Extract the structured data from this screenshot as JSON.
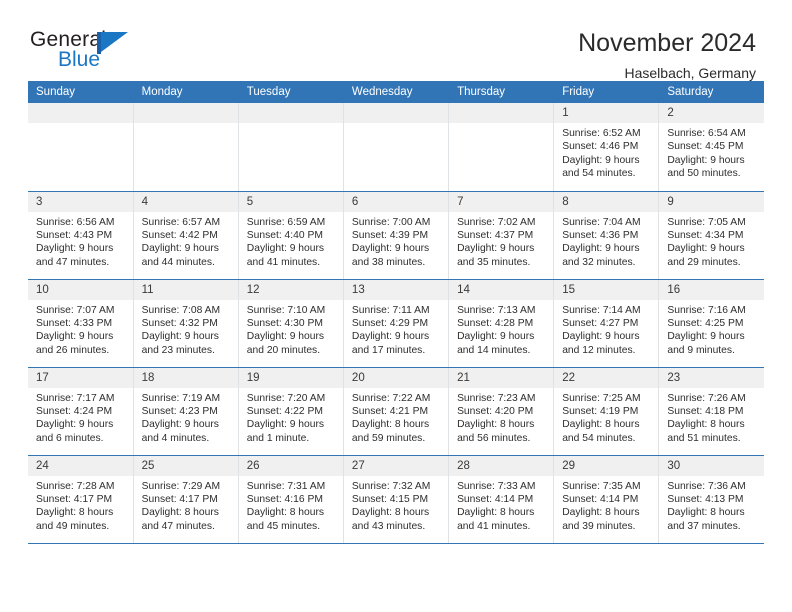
{
  "logo": {
    "word_top": "General",
    "word_bottom": "Blue",
    "flag_icon": "general-blue-flag-icon",
    "color_blue": "#1b77c4",
    "color_dark_blue": "#1b5fa8",
    "color_text": "#231f20"
  },
  "header": {
    "month_year": "November 2024",
    "location": "Haselbach, Germany"
  },
  "theme": {
    "header_blue": "#3275b6",
    "daynum_band": "#f0f0f0",
    "row_divider": "#3275b6",
    "column_divider": "#dfe3e6"
  },
  "calendar": {
    "weekday_headers": [
      "Sunday",
      "Monday",
      "Tuesday",
      "Wednesday",
      "Thursday",
      "Friday",
      "Saturday"
    ],
    "labels": {
      "sunrise": "Sunrise:",
      "sunset": "Sunset:",
      "daylight": "Daylight:"
    },
    "weeks": [
      [
        {
          "day": "",
          "blank": true,
          "sunrise": "",
          "sunset": "",
          "daylight_line1": "",
          "daylight_line2": ""
        },
        {
          "day": "",
          "blank": true,
          "sunrise": "",
          "sunset": "",
          "daylight_line1": "",
          "daylight_line2": ""
        },
        {
          "day": "",
          "blank": true,
          "sunrise": "",
          "sunset": "",
          "daylight_line1": "",
          "daylight_line2": ""
        },
        {
          "day": "",
          "blank": true,
          "sunrise": "",
          "sunset": "",
          "daylight_line1": "",
          "daylight_line2": ""
        },
        {
          "day": "",
          "blank": true,
          "sunrise": "",
          "sunset": "",
          "daylight_line1": "",
          "daylight_line2": ""
        },
        {
          "day": "1",
          "blank": false,
          "sunrise": "Sunrise: 6:52 AM",
          "sunset": "Sunset: 4:46 PM",
          "daylight_line1": "Daylight: 9 hours",
          "daylight_line2": "and 54 minutes."
        },
        {
          "day": "2",
          "blank": false,
          "sunrise": "Sunrise: 6:54 AM",
          "sunset": "Sunset: 4:45 PM",
          "daylight_line1": "Daylight: 9 hours",
          "daylight_line2": "and 50 minutes."
        }
      ],
      [
        {
          "day": "3",
          "blank": false,
          "sunrise": "Sunrise: 6:56 AM",
          "sunset": "Sunset: 4:43 PM",
          "daylight_line1": "Daylight: 9 hours",
          "daylight_line2": "and 47 minutes."
        },
        {
          "day": "4",
          "blank": false,
          "sunrise": "Sunrise: 6:57 AM",
          "sunset": "Sunset: 4:42 PM",
          "daylight_line1": "Daylight: 9 hours",
          "daylight_line2": "and 44 minutes."
        },
        {
          "day": "5",
          "blank": false,
          "sunrise": "Sunrise: 6:59 AM",
          "sunset": "Sunset: 4:40 PM",
          "daylight_line1": "Daylight: 9 hours",
          "daylight_line2": "and 41 minutes."
        },
        {
          "day": "6",
          "blank": false,
          "sunrise": "Sunrise: 7:00 AM",
          "sunset": "Sunset: 4:39 PM",
          "daylight_line1": "Daylight: 9 hours",
          "daylight_line2": "and 38 minutes."
        },
        {
          "day": "7",
          "blank": false,
          "sunrise": "Sunrise: 7:02 AM",
          "sunset": "Sunset: 4:37 PM",
          "daylight_line1": "Daylight: 9 hours",
          "daylight_line2": "and 35 minutes."
        },
        {
          "day": "8",
          "blank": false,
          "sunrise": "Sunrise: 7:04 AM",
          "sunset": "Sunset: 4:36 PM",
          "daylight_line1": "Daylight: 9 hours",
          "daylight_line2": "and 32 minutes."
        },
        {
          "day": "9",
          "blank": false,
          "sunrise": "Sunrise: 7:05 AM",
          "sunset": "Sunset: 4:34 PM",
          "daylight_line1": "Daylight: 9 hours",
          "daylight_line2": "and 29 minutes."
        }
      ],
      [
        {
          "day": "10",
          "blank": false,
          "sunrise": "Sunrise: 7:07 AM",
          "sunset": "Sunset: 4:33 PM",
          "daylight_line1": "Daylight: 9 hours",
          "daylight_line2": "and 26 minutes."
        },
        {
          "day": "11",
          "blank": false,
          "sunrise": "Sunrise: 7:08 AM",
          "sunset": "Sunset: 4:32 PM",
          "daylight_line1": "Daylight: 9 hours",
          "daylight_line2": "and 23 minutes."
        },
        {
          "day": "12",
          "blank": false,
          "sunrise": "Sunrise: 7:10 AM",
          "sunset": "Sunset: 4:30 PM",
          "daylight_line1": "Daylight: 9 hours",
          "daylight_line2": "and 20 minutes."
        },
        {
          "day": "13",
          "blank": false,
          "sunrise": "Sunrise: 7:11 AM",
          "sunset": "Sunset: 4:29 PM",
          "daylight_line1": "Daylight: 9 hours",
          "daylight_line2": "and 17 minutes."
        },
        {
          "day": "14",
          "blank": false,
          "sunrise": "Sunrise: 7:13 AM",
          "sunset": "Sunset: 4:28 PM",
          "daylight_line1": "Daylight: 9 hours",
          "daylight_line2": "and 14 minutes."
        },
        {
          "day": "15",
          "blank": false,
          "sunrise": "Sunrise: 7:14 AM",
          "sunset": "Sunset: 4:27 PM",
          "daylight_line1": "Daylight: 9 hours",
          "daylight_line2": "and 12 minutes."
        },
        {
          "day": "16",
          "blank": false,
          "sunrise": "Sunrise: 7:16 AM",
          "sunset": "Sunset: 4:25 PM",
          "daylight_line1": "Daylight: 9 hours",
          "daylight_line2": "and 9 minutes."
        }
      ],
      [
        {
          "day": "17",
          "blank": false,
          "sunrise": "Sunrise: 7:17 AM",
          "sunset": "Sunset: 4:24 PM",
          "daylight_line1": "Daylight: 9 hours",
          "daylight_line2": "and 6 minutes."
        },
        {
          "day": "18",
          "blank": false,
          "sunrise": "Sunrise: 7:19 AM",
          "sunset": "Sunset: 4:23 PM",
          "daylight_line1": "Daylight: 9 hours",
          "daylight_line2": "and 4 minutes."
        },
        {
          "day": "19",
          "blank": false,
          "sunrise": "Sunrise: 7:20 AM",
          "sunset": "Sunset: 4:22 PM",
          "daylight_line1": "Daylight: 9 hours",
          "daylight_line2": "and 1 minute."
        },
        {
          "day": "20",
          "blank": false,
          "sunrise": "Sunrise: 7:22 AM",
          "sunset": "Sunset: 4:21 PM",
          "daylight_line1": "Daylight: 8 hours",
          "daylight_line2": "and 59 minutes."
        },
        {
          "day": "21",
          "blank": false,
          "sunrise": "Sunrise: 7:23 AM",
          "sunset": "Sunset: 4:20 PM",
          "daylight_line1": "Daylight: 8 hours",
          "daylight_line2": "and 56 minutes."
        },
        {
          "day": "22",
          "blank": false,
          "sunrise": "Sunrise: 7:25 AM",
          "sunset": "Sunset: 4:19 PM",
          "daylight_line1": "Daylight: 8 hours",
          "daylight_line2": "and 54 minutes."
        },
        {
          "day": "23",
          "blank": false,
          "sunrise": "Sunrise: 7:26 AM",
          "sunset": "Sunset: 4:18 PM",
          "daylight_line1": "Daylight: 8 hours",
          "daylight_line2": "and 51 minutes."
        }
      ],
      [
        {
          "day": "24",
          "blank": false,
          "sunrise": "Sunrise: 7:28 AM",
          "sunset": "Sunset: 4:17 PM",
          "daylight_line1": "Daylight: 8 hours",
          "daylight_line2": "and 49 minutes."
        },
        {
          "day": "25",
          "blank": false,
          "sunrise": "Sunrise: 7:29 AM",
          "sunset": "Sunset: 4:17 PM",
          "daylight_line1": "Daylight: 8 hours",
          "daylight_line2": "and 47 minutes."
        },
        {
          "day": "26",
          "blank": false,
          "sunrise": "Sunrise: 7:31 AM",
          "sunset": "Sunset: 4:16 PM",
          "daylight_line1": "Daylight: 8 hours",
          "daylight_line2": "and 45 minutes."
        },
        {
          "day": "27",
          "blank": false,
          "sunrise": "Sunrise: 7:32 AM",
          "sunset": "Sunset: 4:15 PM",
          "daylight_line1": "Daylight: 8 hours",
          "daylight_line2": "and 43 minutes."
        },
        {
          "day": "28",
          "blank": false,
          "sunrise": "Sunrise: 7:33 AM",
          "sunset": "Sunset: 4:14 PM",
          "daylight_line1": "Daylight: 8 hours",
          "daylight_line2": "and 41 minutes."
        },
        {
          "day": "29",
          "blank": false,
          "sunrise": "Sunrise: 7:35 AM",
          "sunset": "Sunset: 4:14 PM",
          "daylight_line1": "Daylight: 8 hours",
          "daylight_line2": "and 39 minutes."
        },
        {
          "day": "30",
          "blank": false,
          "sunrise": "Sunrise: 7:36 AM",
          "sunset": "Sunset: 4:13 PM",
          "daylight_line1": "Daylight: 8 hours",
          "daylight_line2": "and 37 minutes."
        }
      ]
    ]
  }
}
